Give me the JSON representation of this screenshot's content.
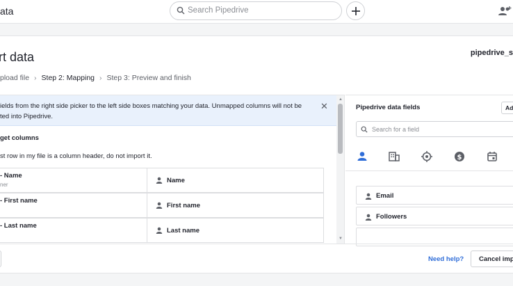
{
  "topbar": {
    "app_title": "ata",
    "search_placeholder": "Search Pipedrive"
  },
  "page": {
    "title": "rt data",
    "file_name": "pipedrive_s",
    "steps": [
      "pload file",
      "Step 2:  Mapping",
      "Step 3:  Preview and finish"
    ]
  },
  "banner": {
    "line1": "ields from the right side picker to the left side boxes matching your data. Unmapped columns will not be",
    "line2": "ted into Pipedrive."
  },
  "mapping": {
    "section_title": "get columns",
    "header_option": "st row in my file is a column header, do not import it.",
    "rows": [
      {
        "source": "- Name",
        "sample": "ner",
        "target": "Name"
      },
      {
        "source": "- First name",
        "sample": "",
        "target": "First name"
      },
      {
        "source": "- Last name",
        "sample": "",
        "target": "Last name"
      }
    ]
  },
  "picker": {
    "title": "Pipedrive data fields",
    "add_label": "Ad",
    "search_placeholder": "Search for a field",
    "tabs": [
      "person-icon",
      "organization-icon",
      "target-icon",
      "dollar-icon",
      "calendar-icon"
    ],
    "fields": [
      "Email",
      "Followers"
    ]
  },
  "footer": {
    "help": "Need help?",
    "cancel": "Cancel imp"
  },
  "colors": {
    "accent": "#2f6dd8",
    "banner_bg": "#e9f1fc"
  }
}
